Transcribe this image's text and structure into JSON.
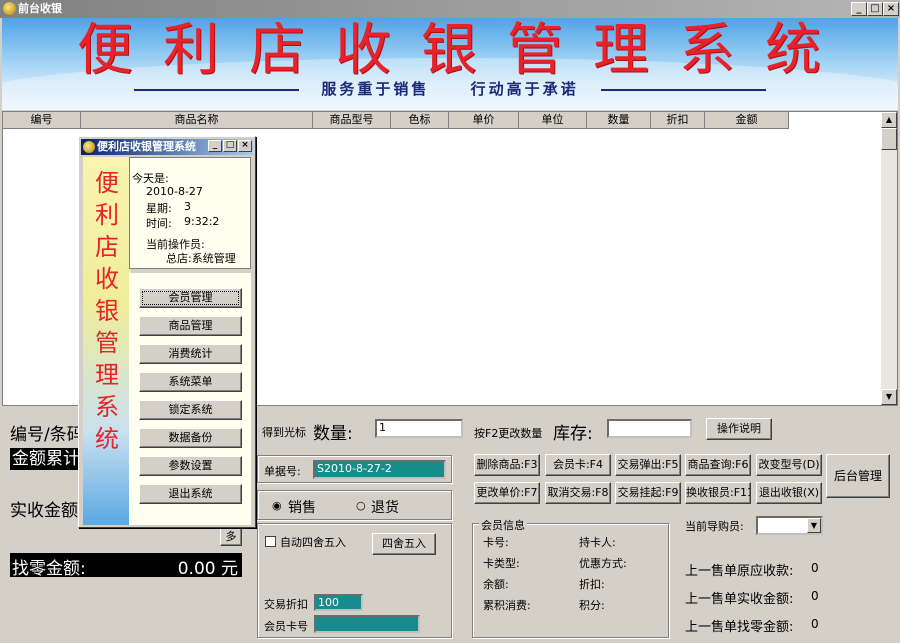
{
  "window": {
    "title": "前台收银",
    "btn_min": "_",
    "btn_max": "□",
    "btn_close": "×"
  },
  "banner": {
    "title": "便利店收银管理系统",
    "slogan_left": "服务重于销售",
    "slogan_right": "行动高于承诺"
  },
  "grid": {
    "columns": [
      "编号",
      "商品名称",
      "商品型号",
      "色标",
      "单价",
      "单位",
      "数量",
      "折扣",
      "金额"
    ]
  },
  "left": {
    "code_label": "编号/条码",
    "sum_label": "金额累计",
    "received_label": "实收金额",
    "more": "多",
    "change_label": "找零金额:",
    "change_value": "0.00 元"
  },
  "mid": {
    "scan_label": "得到光标",
    "qty_label": "数量:",
    "qty_value": "1",
    "f2_hint": "按F2更改数量",
    "stock_label": "库存:",
    "help_button": "操作说明",
    "order_label": "单据号:",
    "order_value": "S2010-8-27-2",
    "radio_sale": "销售",
    "radio_return": "退货",
    "auto_round_label": "自动四舍五入",
    "round_button": "四舍五入",
    "discount_label": "交易折扣",
    "discount_value": "100",
    "member_card_label": "会员卡号"
  },
  "functions": {
    "row1": [
      "删除商品:F3",
      "会员卡:F4",
      "交易弹出:F5",
      "商品查询:F6",
      "改变型号(D)"
    ],
    "row2": [
      "更改单价:F7",
      "取消交易:F8",
      "交易挂起:F9",
      "换收银员:F11",
      "退出收银(X)"
    ],
    "backend": "后台管理"
  },
  "member": {
    "group_title": "会员信息",
    "card_no": "卡号:",
    "holder": "持卡人:",
    "card_type": "卡类型:",
    "discount_method": "优惠方式:",
    "balance": "余额:",
    "rebate": "折扣:",
    "total_spend": "累积消费:",
    "points": "积分:"
  },
  "right": {
    "guide_label": "当前导购员:",
    "last_receivable_label": "上一售单原应收款:",
    "last_receivable_value": "0",
    "last_received_label": "上一售单实收金额:",
    "last_received_value": "0",
    "last_change_label": "上一售单找零金额:",
    "last_change_value": "0"
  },
  "dialog": {
    "title": "便利店收银管理系统",
    "side_chars": [
      "便",
      "利",
      "店",
      "收",
      "银",
      "管",
      "理",
      "系",
      "统"
    ],
    "today_label": "今天是:",
    "date": "2010-8-27",
    "week_label": "星期:",
    "week_value": "3",
    "time_label": "时间:",
    "time_value": "9:32:2",
    "operator_label": "当前操作员:",
    "operator_value": "总店:系统管理",
    "menu": [
      "会员管理",
      "商品管理",
      "消费统计",
      "系统菜单",
      "锁定系统",
      "数据备份",
      "参数设置",
      "退出系统"
    ]
  }
}
